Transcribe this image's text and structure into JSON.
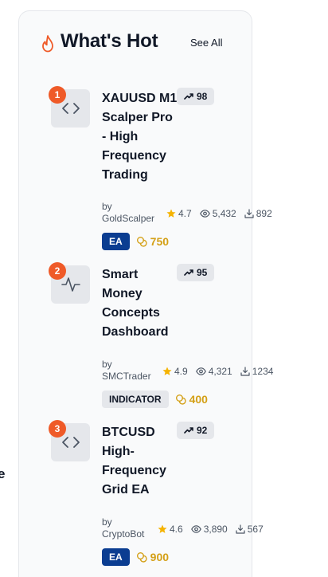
{
  "edge_text": "e",
  "header": {
    "title": "What's Hot",
    "see_all": "See All"
  },
  "items": [
    {
      "rank": "1",
      "icon": "code-icon",
      "name": "XAUUSD M1 Scalper Pro - High Frequency Trading",
      "score": "98",
      "by_label": "by",
      "author": "GoldScalper",
      "rating": "4.7",
      "views": "5,432",
      "downloads": "892",
      "type": "EA",
      "price": "750"
    },
    {
      "rank": "2",
      "icon": "pulse-icon",
      "name": "Smart Money Concepts Dashboard",
      "score": "95",
      "by_label": "by",
      "author": "SMCTrader",
      "rating": "4.9",
      "views": "4,321",
      "downloads": "1234",
      "type": "INDICATOR",
      "price": "400"
    },
    {
      "rank": "3",
      "icon": "code-icon",
      "name": "BTCUSD High-Frequency Grid EA",
      "score": "92",
      "by_label": "by",
      "author": "CryptoBot",
      "rating": "4.6",
      "views": "3,890",
      "downloads": "567",
      "type": "EA",
      "price": "900"
    }
  ],
  "colors": {
    "rank_badge": "#ef5a28",
    "ea_badge": "#0b3d91",
    "price": "#d4a017",
    "star": "#f5b301"
  }
}
